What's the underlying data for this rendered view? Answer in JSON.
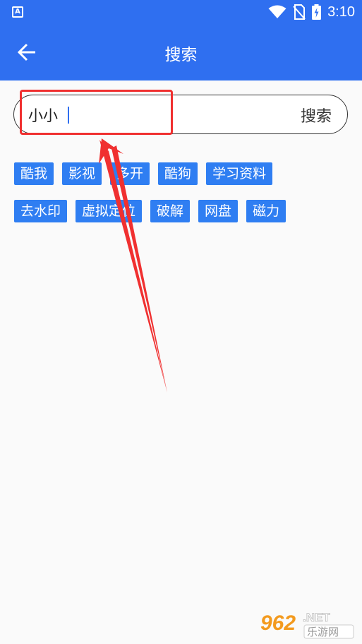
{
  "status_bar": {
    "app_icon_letter": "A",
    "time": "3:10"
  },
  "app_bar": {
    "title": "搜索"
  },
  "search": {
    "input_value": "小小",
    "button_label": "搜索"
  },
  "tags": {
    "row1": [
      "酷我",
      "影视",
      "多开",
      "酷狗",
      "学习资料"
    ],
    "row2": [
      "去水印",
      "虚拟定位",
      "破解",
      "网盘",
      "磁力"
    ]
  },
  "watermark": {
    "brand_number": "962",
    "brand_suffix": ".NET",
    "brand_text": "乐游网"
  },
  "colors": {
    "primary": "#2f6ff0",
    "tag": "#2f7ef2",
    "annotation": "#f03030"
  }
}
